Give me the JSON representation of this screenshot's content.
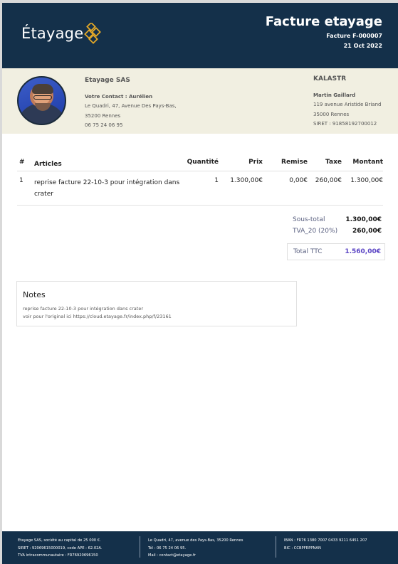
{
  "header": {
    "logo_text": "Étayage",
    "title": "Facture etayage",
    "invoice_number": "Facture F-000007",
    "date": "21 Oct 2022"
  },
  "seller": {
    "company": "Etayage SAS",
    "contact": "Votre Contact : Aurélien",
    "address1": "Le Quadri, 47, Avenue Des Pays-Bas,",
    "address2": "35200 Rennes",
    "phone": "06 75 24 06 95"
  },
  "client": {
    "company": "KALASTR",
    "person": "Martin Gaillard",
    "address1": "119 avenue Aristide Briand",
    "address2": "35000 Rennes",
    "siret": "SIRET : 91858192700012"
  },
  "table": {
    "headers": {
      "num": "#",
      "article": "Articles",
      "qty": "Quantité",
      "price": "Prix",
      "discount": "Remise",
      "tax": "Taxe",
      "amount": "Montant"
    },
    "rows": [
      {
        "num": "1",
        "article": "reprise facture 22-10-3 pour intégration dans crater",
        "qty": "1",
        "price": "1.300,00€",
        "discount": "0,00€",
        "tax": "260,00€",
        "amount": "1.300,00€"
      }
    ]
  },
  "totals": {
    "subtotal_label": "Sous-total",
    "subtotal": "1.300,00€",
    "vat_label": "TVA_20 (20%)",
    "vat": "260,00€",
    "total_label": "Total TTC",
    "total": "1.560,00€"
  },
  "notes": {
    "title": "Notes",
    "line1": "reprise facture 22-10-3 pour intégration dans crater",
    "line2": "voir pour l'original ici https://cloud.etayage.fr/index.php/f/23161"
  },
  "footer": {
    "col1": [
      "Etayage SAS, société au capital de 25 000 €.",
      "SIRET : 92069615000019, code APE : 62.02A.",
      "TVA intracommunautaire : FR76920696150"
    ],
    "col2": [
      "Le Quadri, 47, avenue des Pays-Bas, 35200 Rennes",
      "Tél : 06 75 24 06 95.",
      "Mail : contact@etayage.fr"
    ],
    "col3": [
      "IBAN : FR76 1380 7007 0433 9211 6451 207",
      "BIC : CCBPFRPPNAN"
    ]
  },
  "colors": {
    "header_bg": "#14304a",
    "band_bg": "#f1efe1",
    "accent_total": "#5b45c4",
    "logo_mark": "#e3a828"
  },
  "icons": {
    "logo_mark": "interlocking-diamonds-logo",
    "avatar": "seller-contact-photo"
  }
}
